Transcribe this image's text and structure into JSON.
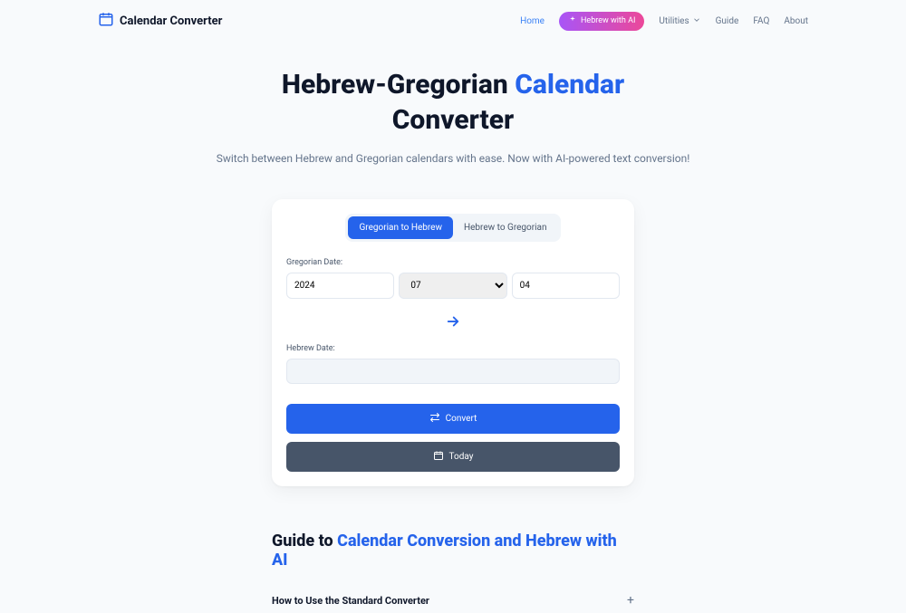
{
  "brand": {
    "title": "Calendar Converter"
  },
  "nav": {
    "home": "Home",
    "hebrewAi": "Hebrew with AI",
    "utilities": "Utilities",
    "guide": "Guide",
    "faq": "FAQ",
    "about": "About"
  },
  "hero": {
    "title_plain1": "Hebrew-Gregorian ",
    "title_accent": "Calendar",
    "title_plain2": " Converter",
    "subtitle": "Switch between Hebrew and Gregorian calendars with ease. Now with AI-powered text conversion!"
  },
  "tabs": {
    "g2h": "Gregorian to Hebrew",
    "h2g": "Hebrew to Gregorian"
  },
  "form": {
    "gregorian_label": "Gregorian Date:",
    "year_value": "2024",
    "month_value": "07",
    "day_value": "04",
    "hebrew_label": "Hebrew Date:",
    "convert": "Convert",
    "today": "Today"
  },
  "guide": {
    "title_plain": "Guide to ",
    "title_accent": "Calendar Conversion and Hebrew with AI",
    "acc1": "How to Use the Standard Converter"
  }
}
